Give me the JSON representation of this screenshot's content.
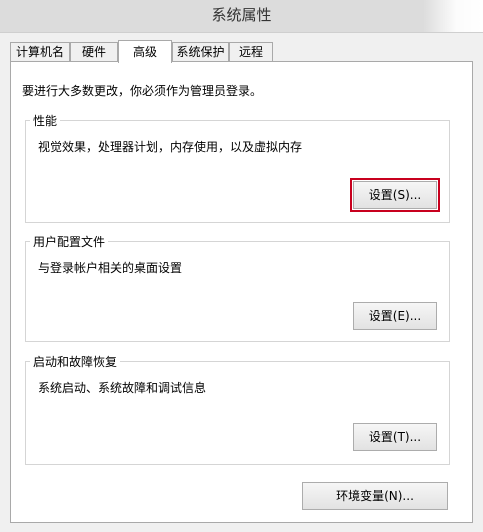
{
  "window": {
    "title": "系统属性"
  },
  "tabs": [
    {
      "label": "计算机名",
      "active": false
    },
    {
      "label": "硬件",
      "active": false
    },
    {
      "label": "高级",
      "active": true
    },
    {
      "label": "系统保护",
      "active": false
    },
    {
      "label": "远程",
      "active": false
    }
  ],
  "advanced": {
    "notice": "要进行大多数更改，你必须作为管理员登录。",
    "performance": {
      "title": "性能",
      "description": "视觉效果，处理器计划，内存使用，以及虚拟内存",
      "button": "设置(S)..."
    },
    "user_profiles": {
      "title": "用户配置文件",
      "description": "与登录帐户相关的桌面设置",
      "button": "设置(E)..."
    },
    "startup_recovery": {
      "title": "启动和故障恢复",
      "description": "系统启动、系统故障和调试信息",
      "button": "设置(T)..."
    },
    "env_button": "环境变量(N)..."
  },
  "colors": {
    "highlight_border": "#c8001e"
  }
}
